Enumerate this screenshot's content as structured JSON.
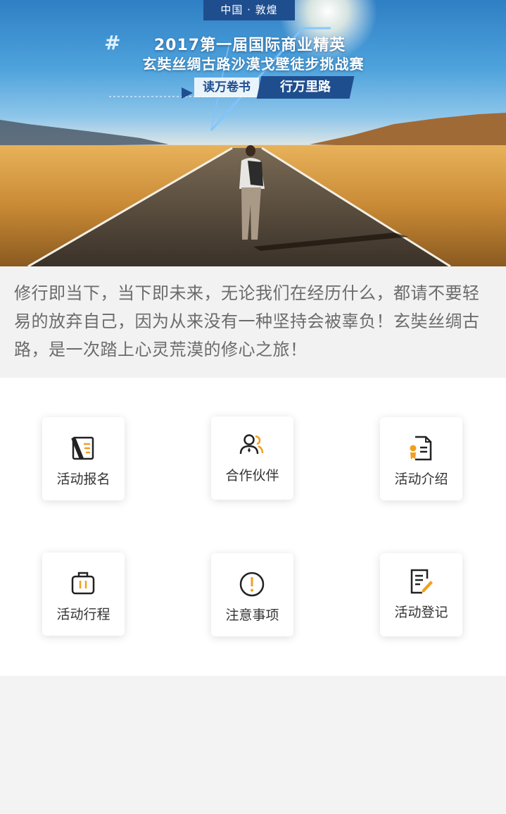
{
  "banner": {
    "location_tag": "中国 · 敦煌",
    "hash": "#",
    "title_line1": "2017第一届国际商业精英",
    "title_line2": "玄奘丝绸古路沙漠戈壁徒步挑战赛",
    "slogan_left": "读万卷书",
    "slogan_right": "行万里路"
  },
  "intro": {
    "text": "修行即当下，当下即未来，无论我们在经历什么，都请不要轻易的放弃自己，因为从来没有一种坚持会被辜负！玄奘丝绸古路，是一次踏上心灵荒漠的修心之旅！"
  },
  "menu": {
    "items": [
      {
        "label": "活动报名",
        "icon": "signup-icon"
      },
      {
        "label": "合作伙伴",
        "icon": "partners-icon"
      },
      {
        "label": "活动介绍",
        "icon": "document-icon"
      },
      {
        "label": "活动行程",
        "icon": "luggage-icon"
      },
      {
        "label": "注意事项",
        "icon": "warning-icon"
      },
      {
        "label": "活动登记",
        "icon": "register-icon"
      }
    ]
  },
  "colors": {
    "accent_orange": "#f0a020",
    "icon_dark": "#222222",
    "tag_blue": "#1f4e8f"
  }
}
